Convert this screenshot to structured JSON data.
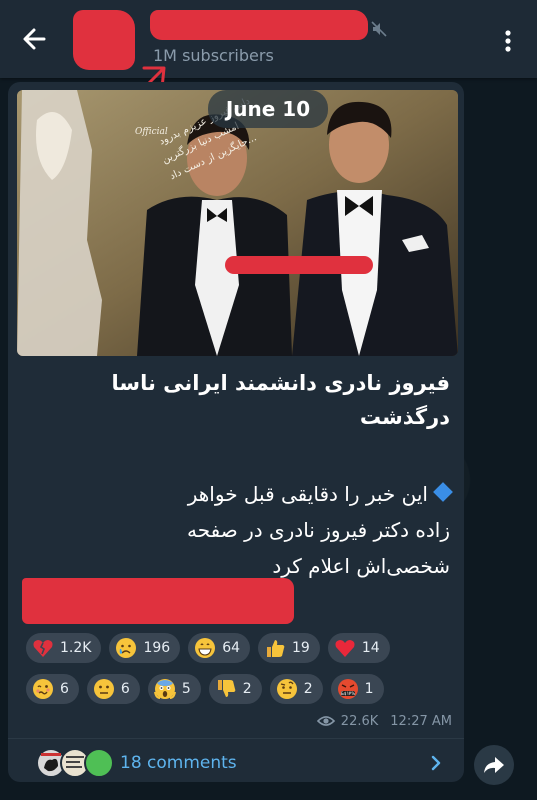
{
  "header": {
    "subscribers": "1M subscribers"
  },
  "post": {
    "date_pill": "June 10",
    "photo_overlay_text": "دایی فیروز عزیزم بدرود امشب دنیا بزرگترین جایگزین از دست داد...",
    "headline_line1": "فیروز نادری دانشمند ایرانی ناسا",
    "headline_line2": "درگذشت",
    "body_line1": "این خبر را دقایقی قبل خواهر",
    "body_line2": "زاده دکتر فیروز نادری در صفحه",
    "body_line3": "شخصی‌اش اعلام کرد",
    "views": "22.6K",
    "time": "12:27 AM"
  },
  "reactions_row1": [
    {
      "emoji": "broken-heart",
      "count": "1.2K"
    },
    {
      "emoji": "crying-face",
      "count": "196"
    },
    {
      "emoji": "grinning-face",
      "count": "64"
    },
    {
      "emoji": "thumbs-up",
      "count": "19"
    },
    {
      "emoji": "red-heart",
      "count": "14"
    }
  ],
  "reactions_row2": [
    {
      "emoji": "woozy-face",
      "count": "6"
    },
    {
      "emoji": "neutral-face",
      "count": "6"
    },
    {
      "emoji": "screaming-face",
      "count": "5"
    },
    {
      "emoji": "thumbs-down",
      "count": "2"
    },
    {
      "emoji": "raised-eyebrow-face",
      "count": "2"
    },
    {
      "emoji": "cursing-face",
      "count": "1"
    }
  ],
  "comments": {
    "label": "18 comments"
  },
  "colors": {
    "accent": "#5eb4ee",
    "redaction": "#e0313e",
    "bubble": "#1f2c38",
    "header": "#1e2a36"
  }
}
